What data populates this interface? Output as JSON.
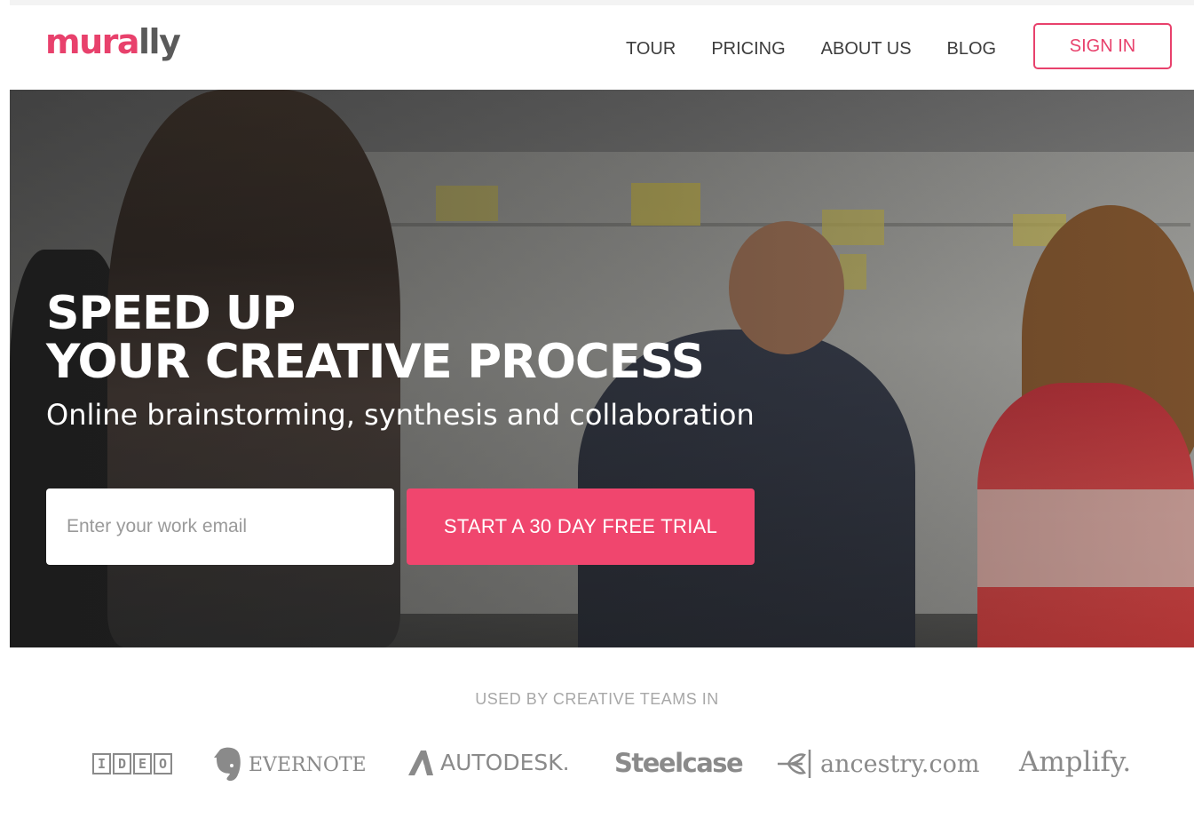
{
  "brand": {
    "logo_part1": "mura",
    "logo_part2": "lly",
    "accent": "#e8416c"
  },
  "nav": {
    "items": [
      {
        "label": "TOUR"
      },
      {
        "label": "PRICING"
      },
      {
        "label": "ABOUT US"
      },
      {
        "label": "BLOG"
      }
    ],
    "signin_label": "SIGN IN"
  },
  "hero": {
    "title_line1": "SPEED UP",
    "title_line2": "YOUR CREATIVE PROCESS",
    "subtitle": "Online brainstorming, synthesis and collaboration",
    "email_placeholder": "Enter your work email",
    "cta_label": "START A 30 DAY FREE TRIAL",
    "cta_color": "#f0466e"
  },
  "clients": {
    "heading": "USED BY CREATIVE TEAMS IN",
    "ideo_letters": [
      "I",
      "D",
      "E",
      "O"
    ],
    "evernote": "EVERNOTE",
    "autodesk": "AUTODESK.",
    "steelcase": "Steelcase",
    "ancestry": "ancestry.com",
    "amplify": "Amplify."
  }
}
